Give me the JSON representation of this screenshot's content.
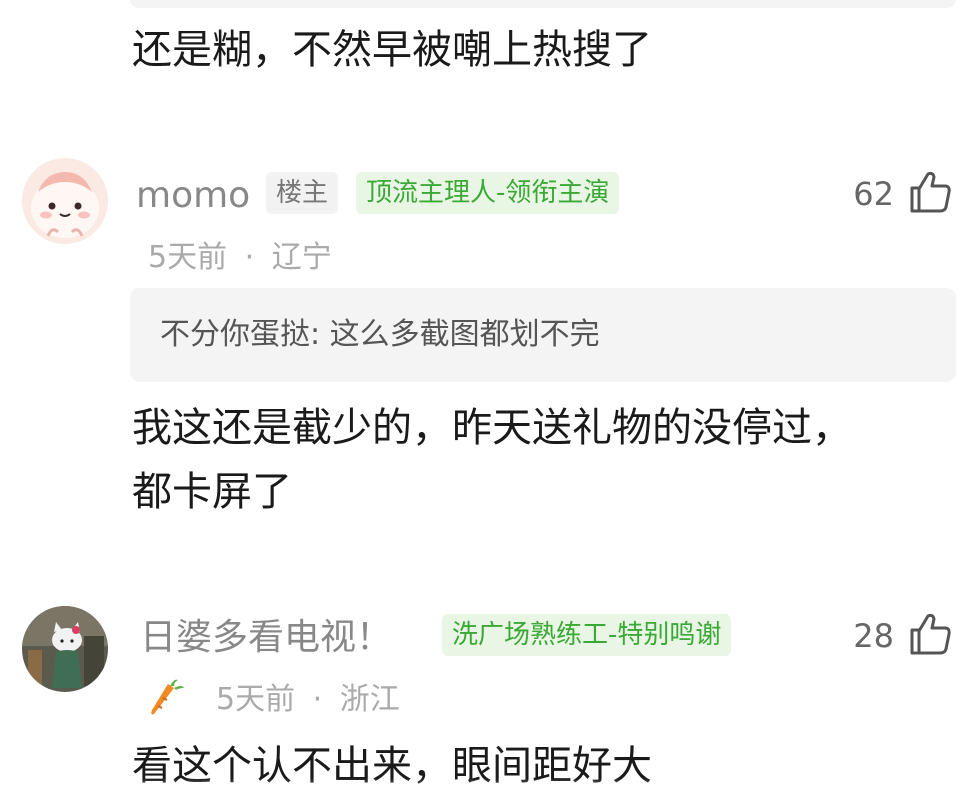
{
  "previous_reply": {
    "text": "还是糊，不然早被嘲上热搜了"
  },
  "comments": [
    {
      "username": "momo",
      "op_badge": "楼主",
      "title_badge": "顶流主理人-领衔主演",
      "likes": "62",
      "time": "5天前",
      "separator": "·",
      "location": "辽宁",
      "quote": "不分你蛋挞: 这么多截图都划不完",
      "text_lines": [
        "我这还是截少的，昨天送礼物的没停过，",
        "都卡屏了"
      ],
      "avatar_icon": "cartoon-face-avatar",
      "like_icon": "thumbs-up-icon"
    },
    {
      "username": "日婆多看电视！",
      "title_badge": "洗广场熟练工-特别鸣谢",
      "likes": "28",
      "decoration_icon": "carrot-icon",
      "time": "5天前",
      "separator": "·",
      "location": "浙江",
      "text_lines": [
        "看这个认不出来，眼间距好大"
      ],
      "avatar_icon": "hello-kitty-avatar",
      "like_icon": "thumbs-up-icon"
    }
  ],
  "colors": {
    "badge_green_text": "#3aa935",
    "badge_green_bg": "#eaf6e5",
    "badge_grey_bg": "#f2f2f2",
    "quote_bg": "#f4f4f4",
    "meta_text": "#aaaaaa",
    "username_text": "#888888"
  }
}
